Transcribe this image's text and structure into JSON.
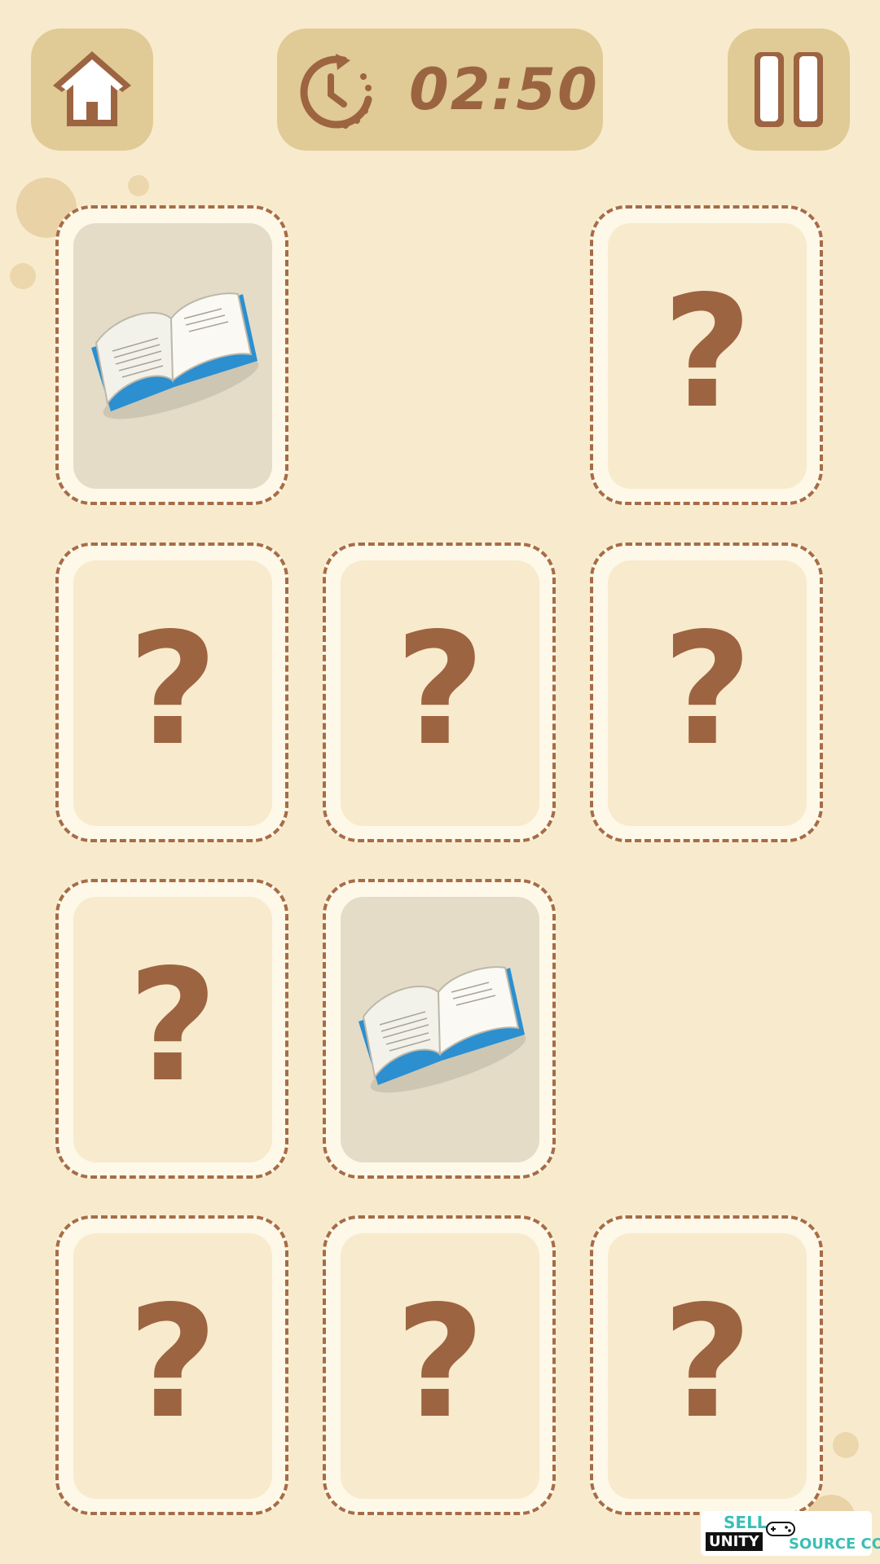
{
  "header": {
    "home_icon": "home-icon",
    "timer_icon": "clock-timer-icon",
    "timer_value": "02:50",
    "pause_icon": "pause-icon"
  },
  "board": {
    "grid": "3 columns x 4 rows",
    "cards": [
      {
        "row": 1,
        "col": 1,
        "state": "face-up",
        "image": "open-book-icon"
      },
      {
        "row": 1,
        "col": 2,
        "state": "empty"
      },
      {
        "row": 1,
        "col": 3,
        "state": "face-down",
        "symbol": "?"
      },
      {
        "row": 2,
        "col": 1,
        "state": "face-down",
        "symbol": "?"
      },
      {
        "row": 2,
        "col": 2,
        "state": "face-down",
        "symbol": "?"
      },
      {
        "row": 2,
        "col": 3,
        "state": "face-down",
        "symbol": "?"
      },
      {
        "row": 3,
        "col": 1,
        "state": "face-down",
        "symbol": "?"
      },
      {
        "row": 3,
        "col": 2,
        "state": "face-up",
        "image": "open-book-icon"
      },
      {
        "row": 3,
        "col": 3,
        "state": "empty"
      },
      {
        "row": 4,
        "col": 1,
        "state": "face-down",
        "symbol": "?"
      },
      {
        "row": 4,
        "col": 2,
        "state": "face-down",
        "symbol": "?"
      },
      {
        "row": 4,
        "col": 3,
        "state": "face-down",
        "symbol": "?"
      }
    ]
  },
  "watermark": {
    "line1": "SELL",
    "line2a": "UNITY",
    "line2b": "SOURCE CODE"
  },
  "colors": {
    "background": "#f8ebcd",
    "button": "#e0ca96",
    "accent_brown": "#9d6441",
    "card_face_open": "#e4dcc7",
    "book_blue": "#2b8fd0"
  }
}
